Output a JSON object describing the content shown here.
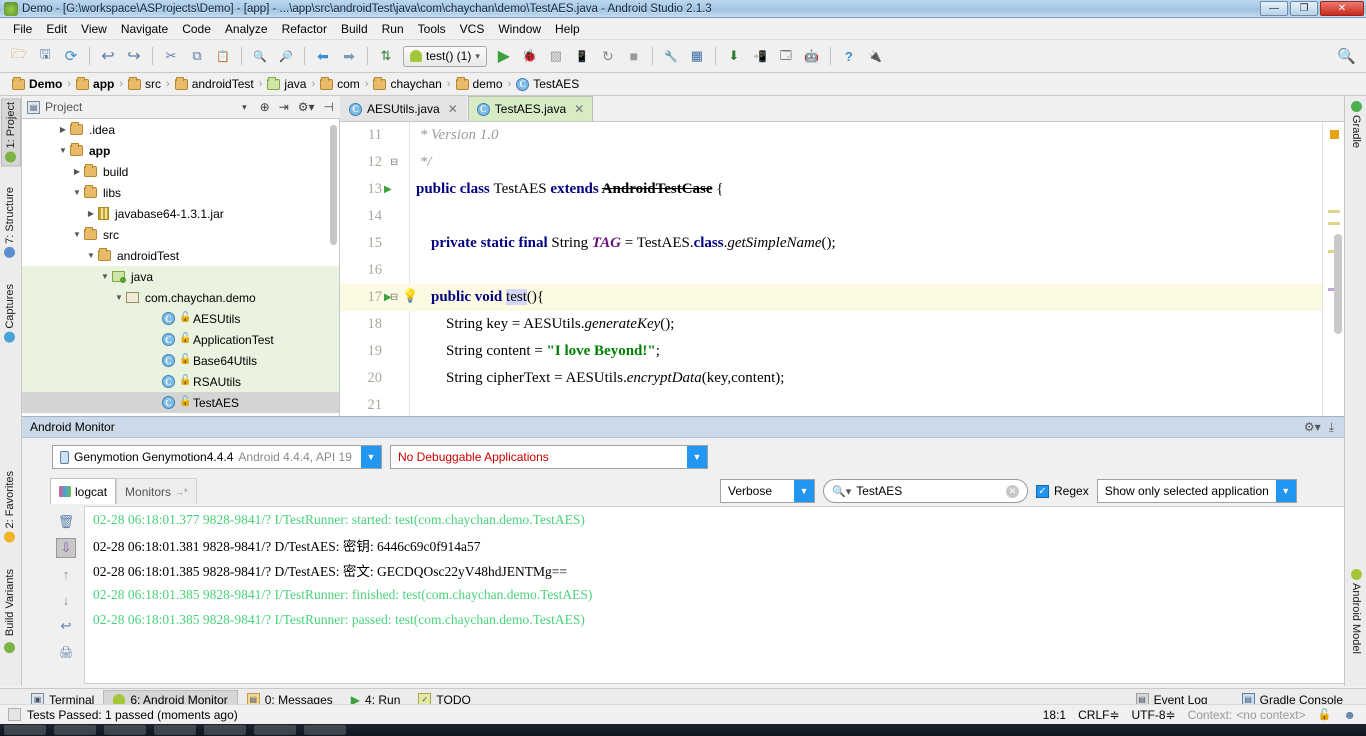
{
  "window": {
    "title": "Demo - [G:\\workspace\\ASProjects\\Demo] - [app] - ...\\app\\src\\androidTest\\java\\com\\chaychan\\demo\\TestAES.java - Android Studio 2.1.3",
    "minimize": "—",
    "maximize": "❐",
    "close": "✕"
  },
  "menubar": {
    "items": [
      "File",
      "Edit",
      "View",
      "Navigate",
      "Code",
      "Analyze",
      "Refactor",
      "Build",
      "Run",
      "Tools",
      "VCS",
      "Window",
      "Help"
    ]
  },
  "toolbar": {
    "icons": [
      {
        "name": "open-project-icon",
        "glyph": "🗁"
      },
      {
        "name": "save-all-icon",
        "glyph": "🖫"
      },
      {
        "name": "sync-icon",
        "glyph": "⟳"
      },
      {
        "name": "undo-icon",
        "glyph": "↩"
      },
      {
        "name": "redo-icon",
        "glyph": "↪"
      },
      {
        "name": "cut-icon",
        "glyph": "✂"
      },
      {
        "name": "copy-icon",
        "glyph": "⧉"
      },
      {
        "name": "paste-icon",
        "glyph": "📋"
      },
      {
        "name": "find-icon",
        "glyph": "🔍"
      },
      {
        "name": "replace-icon",
        "glyph": "🔎"
      },
      {
        "name": "back-icon",
        "glyph": "⬅"
      },
      {
        "name": "forward-icon",
        "glyph": "➡"
      },
      {
        "name": "sort-icon",
        "glyph": "⇅"
      }
    ],
    "run_config_label": "test() (1)",
    "run_config_arrow": "▾",
    "right_icons": [
      {
        "name": "run-icon",
        "glyph": "▶"
      },
      {
        "name": "debug-icon",
        "glyph": "🐞"
      },
      {
        "name": "coverage-icon",
        "glyph": "▨"
      },
      {
        "name": "attach-debugger-icon",
        "glyph": "📱"
      },
      {
        "name": "rerun-icon",
        "glyph": "↻"
      },
      {
        "name": "stop-icon",
        "glyph": "■"
      },
      {
        "name": "sdk-manager-icon",
        "glyph": "🔧"
      },
      {
        "name": "avd-manager-icon",
        "glyph": "▦"
      },
      {
        "name": "sync-gradle-icon",
        "glyph": "⬇"
      },
      {
        "name": "device-monitor-icon",
        "glyph": "📲"
      },
      {
        "name": "layout-inspector-icon",
        "glyph": "🗔"
      },
      {
        "name": "android-icon",
        "glyph": "🤖"
      },
      {
        "name": "help-icon",
        "glyph": "?"
      },
      {
        "name": "device-file-icon",
        "glyph": "🔌"
      }
    ],
    "search_everywhere": "🔍"
  },
  "breadcrumb": {
    "items": [
      {
        "label": "Demo",
        "type": "folder",
        "bold": true
      },
      {
        "label": "app",
        "type": "module",
        "bold": true
      },
      {
        "label": "src",
        "type": "folder",
        "bold": false
      },
      {
        "label": "androidTest",
        "type": "folder",
        "bold": false
      },
      {
        "label": "java",
        "type": "folder-green",
        "bold": false
      },
      {
        "label": "com",
        "type": "folder",
        "bold": false
      },
      {
        "label": "chaychan",
        "type": "folder",
        "bold": false
      },
      {
        "label": "demo",
        "type": "folder",
        "bold": false
      },
      {
        "label": "TestAES",
        "type": "class",
        "bold": false
      }
    ],
    "separator": "›"
  },
  "left_strip": {
    "tabs": [
      {
        "label": "1: Project",
        "selected": true,
        "color": "#7cb342"
      },
      {
        "label": "7: Structure",
        "selected": false,
        "color": "#5b8fd0"
      },
      {
        "label": "Captures",
        "selected": false,
        "color": "#4aa3d8"
      }
    ],
    "bottom_tabs": [
      {
        "label": "2: Favorites",
        "selected": false,
        "color": "#f0b429"
      },
      {
        "label": "Build Variants",
        "selected": false,
        "color": "#7cb342"
      }
    ]
  },
  "right_strip": {
    "top_tabs": [
      {
        "label": "Gradle",
        "color": "#4caf50"
      }
    ],
    "bottom_tabs": [
      {
        "label": "Android Model",
        "color": "#a4c639"
      }
    ]
  },
  "project_panel": {
    "title": "Project",
    "caret": "▾",
    "tools": [
      "⊕",
      "⇥",
      "⚙▾",
      "⊣"
    ],
    "tree": [
      {
        "label": ".idea",
        "indent": 1,
        "twisty": "▶",
        "icon": "folder",
        "state": "normal"
      },
      {
        "label": "app",
        "indent": 1,
        "twisty": "▼",
        "icon": "module",
        "state": "normal",
        "bold": true
      },
      {
        "label": "build",
        "indent": 2,
        "twisty": "▶",
        "icon": "folder",
        "state": "normal"
      },
      {
        "label": "libs",
        "indent": 2,
        "twisty": "▼",
        "icon": "folder",
        "state": "normal"
      },
      {
        "label": "javabase64-1.3.1.jar",
        "indent": 3,
        "twisty": "▶",
        "icon": "jar",
        "state": "normal"
      },
      {
        "label": "src",
        "indent": 2,
        "twisty": "▼",
        "icon": "folder",
        "state": "normal"
      },
      {
        "label": "androidTest",
        "indent": 3,
        "twisty": "▼",
        "icon": "folder",
        "state": "normal"
      },
      {
        "label": "java",
        "indent": 4,
        "twisty": "▼",
        "icon": "java-folder",
        "state": "highlight"
      },
      {
        "label": "com.chaychan.demo",
        "indent": 5,
        "twisty": "▼",
        "icon": "package",
        "state": "highlight"
      },
      {
        "label": "AESUtils",
        "indent": 6,
        "twisty": "",
        "icon": "class",
        "state": "highlight"
      },
      {
        "label": "ApplicationTest",
        "indent": 6,
        "twisty": "",
        "icon": "test-class",
        "state": "highlight"
      },
      {
        "label": "Base64Utils",
        "indent": 6,
        "twisty": "",
        "icon": "class",
        "state": "highlight"
      },
      {
        "label": "RSAUtils",
        "indent": 6,
        "twisty": "",
        "icon": "class",
        "state": "highlight"
      },
      {
        "label": "TestAES",
        "indent": 6,
        "twisty": "",
        "icon": "test-class",
        "state": "selected"
      }
    ]
  },
  "editor": {
    "tabs": [
      {
        "label": "AESUtils.java",
        "active": false,
        "close": "✕",
        "icon": "class"
      },
      {
        "label": "TestAES.java",
        "active": true,
        "close": "✕",
        "icon": "test-class"
      }
    ],
    "lines": [
      {
        "num": "11",
        "content": " * Version 1.0",
        "gutter": "",
        "highlight": false
      },
      {
        "num": "12",
        "content": " */",
        "gutter": "fold",
        "highlight": false
      },
      {
        "num": "13",
        "content": "public class TestAES extends AndroidTestCase {",
        "gutter": "run",
        "highlight": false
      },
      {
        "num": "14",
        "content": "",
        "gutter": "",
        "highlight": false
      },
      {
        "num": "15",
        "content": "    private static final String TAG = TestAES.class.getSimpleName();",
        "gutter": "",
        "highlight": false
      },
      {
        "num": "16",
        "content": "",
        "gutter": "",
        "highlight": false
      },
      {
        "num": "17",
        "content": "    public void test(){",
        "gutter": "run-bulb",
        "highlight": true
      },
      {
        "num": "18",
        "content": "        String key = AESUtils.generateKey();",
        "gutter": "",
        "highlight": false
      },
      {
        "num": "19",
        "content": "        String content = \"I love Beyond!\";",
        "gutter": "",
        "highlight": false
      },
      {
        "num": "20",
        "content": "        String cipherText = AESUtils.encryptData(key,content);",
        "gutter": "",
        "highlight": false
      },
      {
        "num": "21",
        "content": "",
        "gutter": "",
        "highlight": false
      }
    ]
  },
  "android_monitor": {
    "title": "Android Monitor",
    "settings_icon": "⚙▾",
    "hide_icon": "⤓",
    "device_combo": {
      "value": "Genymotion Genymotion4.4.4",
      "detail": "Android 4.4.4, API 19",
      "arrow": "▼"
    },
    "process_combo": {
      "value": "No Debuggable Applications",
      "arrow": "▼"
    },
    "tabs": [
      {
        "label": "logcat",
        "active": true
      },
      {
        "label": "Monitors",
        "active": false,
        "suffix": "→*"
      }
    ],
    "left_tools": [
      {
        "name": "clear-logcat-icon",
        "glyph": "🗑"
      },
      {
        "name": "scroll-to-end-icon",
        "glyph": "⇩"
      },
      {
        "name": "up-icon",
        "glyph": "↑"
      },
      {
        "name": "down-icon",
        "glyph": "↓"
      },
      {
        "name": "soft-wrap-icon",
        "glyph": "↩"
      },
      {
        "name": "print-icon",
        "glyph": "🖨"
      }
    ],
    "level_combo": {
      "value": "Verbose",
      "arrow": "▼"
    },
    "search": {
      "value": "TestAES",
      "icon": "🔍▾",
      "clear": "✕"
    },
    "regex": {
      "label": "Regex",
      "checked": true,
      "check": "✓"
    },
    "scope_combo": {
      "value": "Show only selected application",
      "arrow": "▼"
    },
    "log_lines": [
      {
        "text": "02-28 06:18:01.377 9828-9841/? I/TestRunner: started: test(com.chaychan.demo.TestAES)",
        "level": "I"
      },
      {
        "text": "02-28 06:18:01.381 9828-9841/? D/TestAES: 密钥: 6446c69c0f914a57",
        "level": "D"
      },
      {
        "text": "02-28 06:18:01.385 9828-9841/? D/TestAES: 密文: GECDQOsc22yV48hdJENTMg==",
        "level": "D"
      },
      {
        "text": "02-28 06:18:01.385 9828-9841/? I/TestRunner: finished: test(com.chaychan.demo.TestAES)",
        "level": "I"
      },
      {
        "text": "02-28 06:18:01.385 9828-9841/? I/TestRunner: passed: test(com.chaychan.demo.TestAES)",
        "level": "I"
      }
    ]
  },
  "toolwindow_bar": {
    "tabs": [
      {
        "label": "Terminal",
        "selected": false,
        "icon": "terminal-icon"
      },
      {
        "label": "6: Android Monitor",
        "selected": true,
        "icon": "android-icon"
      },
      {
        "label": "0: Messages",
        "selected": false,
        "icon": "messages-icon"
      },
      {
        "label": "4: Run",
        "selected": false,
        "icon": "run-icon"
      },
      {
        "label": "TODO",
        "selected": false,
        "icon": "todo-icon"
      }
    ],
    "right": [
      {
        "label": "Event Log",
        "icon": "event-log-icon"
      },
      {
        "label": "Gradle Console",
        "icon": "gradle-console-icon"
      }
    ]
  },
  "statusbar": {
    "message": "Tests Passed: 1 passed (moments ago)",
    "caret": "18:1",
    "line_sep": "CRLF≑",
    "encoding": "UTF-8≑",
    "context_label": "Context:",
    "context_value": "<no context>",
    "lock_icon": "🔓",
    "face_icon": "☻"
  },
  "colors": {
    "accent_blue": "#2196f3",
    "title_bg": "#a8c8e6",
    "logcat_info_green": "#4ad27a",
    "warning_red": "#cc0000",
    "keyword_blue": "#000080",
    "string_green": "#008000",
    "field_purple": "#660e7a",
    "selection_highlight": "#fdfae3",
    "tree_highlight": "#e9f3e0"
  }
}
